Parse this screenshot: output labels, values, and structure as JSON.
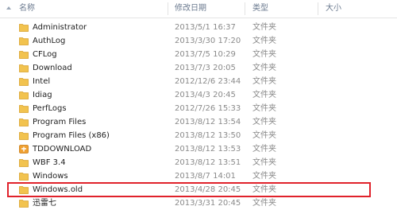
{
  "header": {
    "name": "名称",
    "modified": "修改日期",
    "type": "类型",
    "size": "大小"
  },
  "rows": [
    {
      "name": "Administrator",
      "date": "2013/5/1 16:37",
      "type": "文件夹",
      "size": "",
      "icon": "folder-icon"
    },
    {
      "name": "AuthLog",
      "date": "2013/3/30 17:20",
      "type": "文件夹",
      "size": "",
      "icon": "folder-icon"
    },
    {
      "name": "CFLog",
      "date": "2013/7/5 10:29",
      "type": "文件夹",
      "size": "",
      "icon": "folder-icon"
    },
    {
      "name": "Download",
      "date": "2013/7/3 20:05",
      "type": "文件夹",
      "size": "",
      "icon": "folder-icon"
    },
    {
      "name": "Intel",
      "date": "2012/12/6 23:44",
      "type": "文件夹",
      "size": "",
      "icon": "folder-icon"
    },
    {
      "name": "Idiag",
      "date": "2013/4/3 20:45",
      "type": "文件夹",
      "size": "",
      "icon": "folder-icon"
    },
    {
      "name": "PerfLogs",
      "date": "2012/7/26 15:33",
      "type": "文件夹",
      "size": "",
      "icon": "folder-icon"
    },
    {
      "name": "Program Files",
      "date": "2013/8/12 13:54",
      "type": "文件夹",
      "size": "",
      "icon": "folder-icon"
    },
    {
      "name": "Program Files (x86)",
      "date": "2013/8/12 13:50",
      "type": "文件夹",
      "size": "",
      "icon": "folder-icon"
    },
    {
      "name": "TDDOWNLOAD",
      "date": "2013/8/12 13:53",
      "type": "文件夹",
      "size": "",
      "icon": "tddownload-folder-icon"
    },
    {
      "name": "WBF 3.4",
      "date": "2013/8/12 13:51",
      "type": "文件夹",
      "size": "",
      "icon": "folder-icon"
    },
    {
      "name": "Windows",
      "date": "2013/8/7 14:01",
      "type": "文件夹",
      "size": "",
      "icon": "folder-icon"
    },
    {
      "name": "Windows.old",
      "date": "2013/4/28 20:45",
      "type": "文件夹",
      "size": "",
      "icon": "folder-icon",
      "highlighted": true
    },
    {
      "name": "迅雷七",
      "date": "2013/3/31 20:45",
      "type": "文件夹",
      "size": "",
      "icon": "folder-icon"
    }
  ],
  "colors": {
    "folder": "#f2c34f",
    "folder_dark": "#d9a12a",
    "highlight_border": "#e0222b",
    "tddownload": "#f0a030"
  }
}
